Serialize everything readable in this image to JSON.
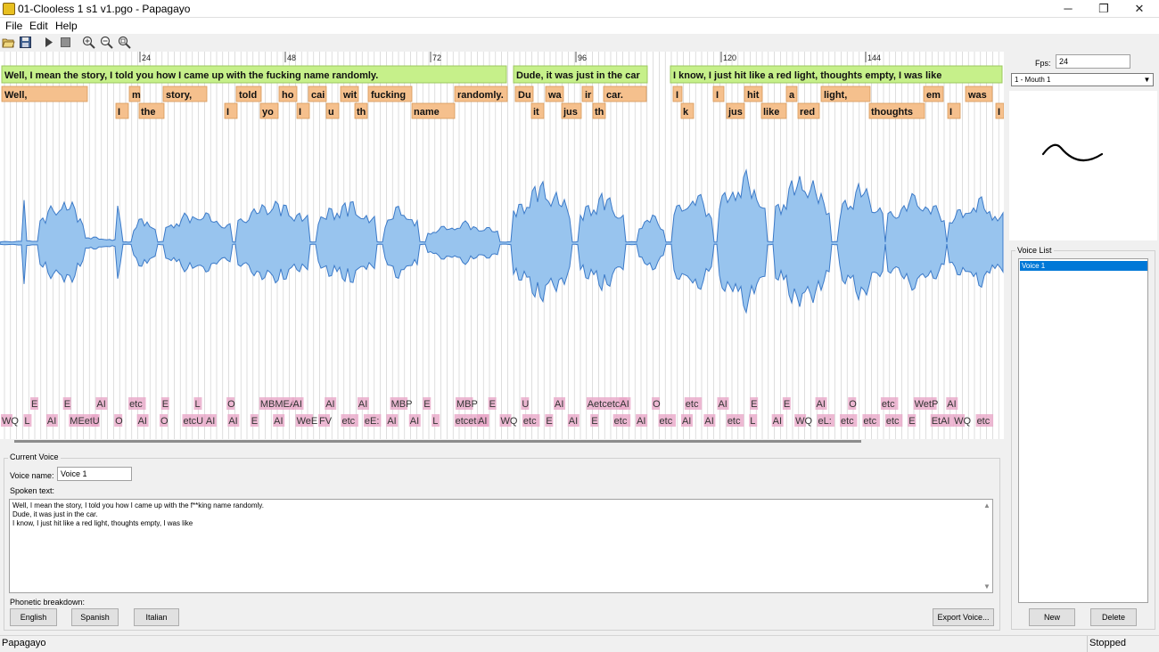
{
  "window": {
    "title": "01-Clooless 1 s1 v1.pgo - Papagayo",
    "minimize_glyph": "─",
    "restore_glyph": "❐",
    "close_glyph": "✕"
  },
  "menu": {
    "items": [
      "File",
      "Edit",
      "Help"
    ]
  },
  "toolbar": {
    "icons": [
      "open-icon",
      "save-icon",
      "play-icon",
      "stop-icon",
      "zoom-in-icon",
      "zoom-out-icon",
      "zoom-fit-icon"
    ]
  },
  "timeline": {
    "ticks": [
      "24",
      "48",
      "72",
      "96",
      "120",
      "144"
    ],
    "phrases": [
      "Well, I mean the story, I told you how I came up with the fucking name randomly.",
      "Dude, it was just in the car",
      "I know, I just hit like a red light, thoughts empty, I was like"
    ],
    "words_row1": [
      "Well,",
      "m",
      "story,",
      "told",
      "ho",
      "cai",
      "wit",
      "fucking",
      "randomly.",
      "Du",
      "wa",
      "ir",
      "car.",
      "I",
      "I",
      "hit",
      "a",
      "light,",
      "em",
      "was"
    ],
    "words_row2": [
      "I",
      "the",
      "I",
      "yo",
      "I",
      "u",
      "th",
      "name",
      "it",
      "jus",
      "th",
      "k",
      "jus",
      "like",
      "red",
      "thoughts",
      "I",
      "I"
    ],
    "phonemes_row1": [
      "E",
      "E",
      "AI",
      "etc",
      "E",
      "L",
      "O",
      "MBMEAI",
      "AI",
      "AI",
      "AI",
      "MBP",
      "E",
      "MBP",
      "E",
      "U",
      "AI",
      "Aetcetc",
      "AI",
      "O",
      "etc",
      "AI",
      "E",
      "E",
      "AI",
      "O",
      "etc",
      "WetP",
      "AI"
    ],
    "phonemes_row2": [
      "WQ",
      "L",
      "AI",
      "MEetc",
      "U",
      "O",
      "AI",
      "O",
      "etcU",
      "AI",
      "AI",
      "E",
      "AI",
      "WeE",
      "FV",
      "etc",
      "eE:",
      "AI",
      "AI",
      "L",
      "etcetc",
      "AI",
      "WQ",
      "etc",
      "E",
      "AI",
      "E",
      "etc",
      "AI",
      "etc",
      "AI",
      "AI",
      "etc",
      "L",
      "AI",
      "WQ",
      "eL:",
      "etc",
      "etc",
      "etc",
      "E",
      "EtAI",
      "WQ",
      "etc"
    ]
  },
  "right_panel": {
    "fps_label": "Fps:",
    "fps_value": "24",
    "mouth_selected": "1 - Mouth 1",
    "voice_list_title": "Voice List",
    "voices": [
      "Voice 1"
    ],
    "new_button": "New",
    "delete_button": "Delete"
  },
  "current_voice": {
    "group_title": "Current Voice",
    "voice_name_label": "Voice name:",
    "voice_name_value": "Voice 1",
    "spoken_text_label": "Spoken text:",
    "spoken_lines": [
      "Well, I mean the story, I told you how I came up with the f**king name randomly.",
      "Dude, it was just in the car.",
      "I know, I just hit like a red light, thoughts empty, I was like"
    ],
    "phonetic_label": "Phonetic breakdown:",
    "buttons": [
      "English",
      "Spanish",
      "Italian"
    ],
    "export_button": "Export Voice..."
  },
  "status": {
    "left": "Papagayo",
    "right": "Stopped"
  },
  "colors": {
    "phrase_bg": "#c6f08a",
    "word_bg": "#f5c08d",
    "phoneme_bg": "#e8a8c8",
    "wave_fill": "#98c4ee",
    "wave_stroke": "#3c7ac8",
    "frame_line": "#c8c8c8"
  }
}
